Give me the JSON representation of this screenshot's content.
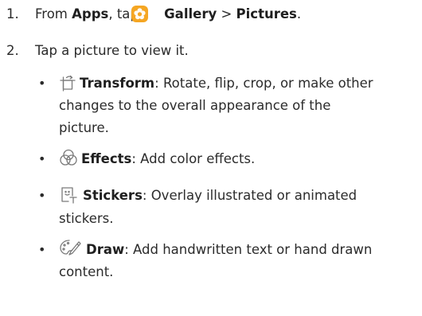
{
  "steps": [
    {
      "number": "1.",
      "prefix": "From ",
      "apps": "Apps",
      "comma_tap": ", tap ",
      "gallery": "Gallery",
      "arrow": " > ",
      "pictures": "Pictures",
      "period": "."
    },
    {
      "number": "2.",
      "text": "Tap a picture to view it."
    }
  ],
  "options": [
    {
      "icon": "transform-icon",
      "label": "Transform",
      "colon": ":",
      "lines": [
        " Rotate, flip, crop, or make other",
        "changes to the overall appearance of the",
        "picture."
      ]
    },
    {
      "icon": "effects-icon",
      "label": "Effects",
      "colon": ":",
      "lines": [
        " Add color effects."
      ]
    },
    {
      "icon": "stickers-icon",
      "label": "Stickers",
      "colon": ":",
      "lines": [
        " Overlay illustrated or animated",
        "stickers."
      ]
    },
    {
      "icon": "draw-icon",
      "label": "Draw",
      "colon": ":",
      "lines": [
        " Add handwritten text or hand drawn",
        "content."
      ]
    }
  ],
  "bullet_char": "•",
  "colors": {
    "text": "#2b2b2b",
    "gallery_icon": "#f5a623",
    "icon_stroke": "#7a7a7a"
  }
}
